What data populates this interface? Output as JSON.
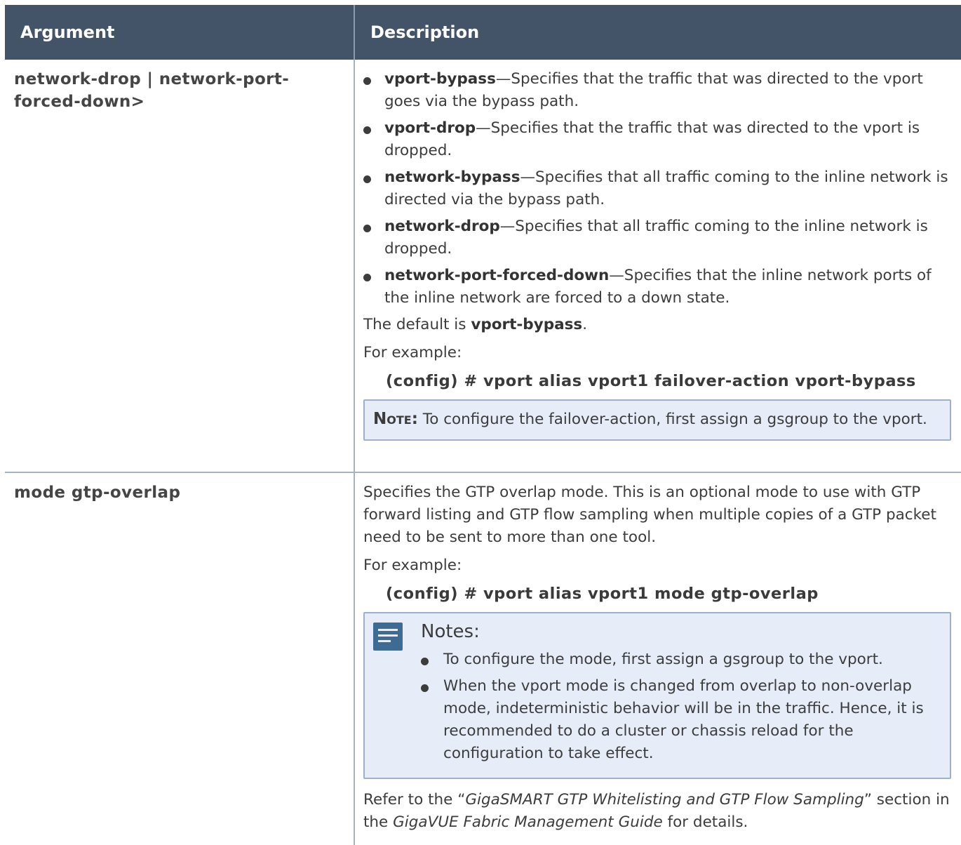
{
  "header": {
    "argument": "Argument",
    "description": "Description"
  },
  "rows": [
    {
      "argument": "network-drop | network-port-forced-down>",
      "bullets": [
        {
          "term": "vport-bypass",
          "text": "—Specifies that the traffic that was directed to the vport goes via the bypass path."
        },
        {
          "term": "vport-drop",
          "text": "—Specifies that the traffic that was directed to the vport is dropped."
        },
        {
          "term": "network-bypass",
          "text": "—Specifies that all traffic coming to the inline network is directed via the bypass path."
        },
        {
          "term": "network-drop",
          "text": "—Specifies that all traffic coming to the inline network is dropped."
        },
        {
          "term": "network-port-forced-down",
          "text": "—Specifies that the inline network ports of the inline network are forced to a down state."
        }
      ],
      "default_prefix": "The default is ",
      "default_value": "vport-bypass",
      "default_suffix": ".",
      "example_label": "For example:",
      "example_code": "(config) # vport alias vport1 failover-action vport-bypass",
      "note_label": "Note:",
      "note_text": " To configure the failover-action, first assign a gsgroup to the vport."
    },
    {
      "argument": "mode gtp-overlap",
      "description": "Specifies the GTP overlap mode. This is an optional mode to use with GTP forward listing and GTP flow sampling when multiple copies of a GTP packet need to be sent to more than one tool.",
      "example_label": "For example:",
      "example_code": "(config) # vport alias vport1 mode gtp-overlap",
      "notes_title": "Notes:",
      "notes": [
        "To configure the mode, first assign a gsgroup to the vport.",
        "When the vport mode is changed from overlap to non-overlap mode, indeterministic behavior will be in the traffic. Hence, it is recommended to do a cluster or chassis reload for the configuration to take effect."
      ],
      "refer_prefix": "Refer to the “",
      "refer_title": "GigaSMART GTP Whitelisting and GTP Flow Sampling",
      "refer_mid": "” section in the ",
      "refer_guide": "GigaVUE Fabric Management Guide",
      "refer_suffix": " for details."
    }
  ],
  "colors": {
    "header_bg": "#435468",
    "note_bg": "#e6edf8",
    "note_border": "#9eb1cc",
    "icon": "#3e6b94"
  },
  "icons": {
    "notes": "document-lines-icon",
    "bullet": "bullet-dot-icon"
  }
}
